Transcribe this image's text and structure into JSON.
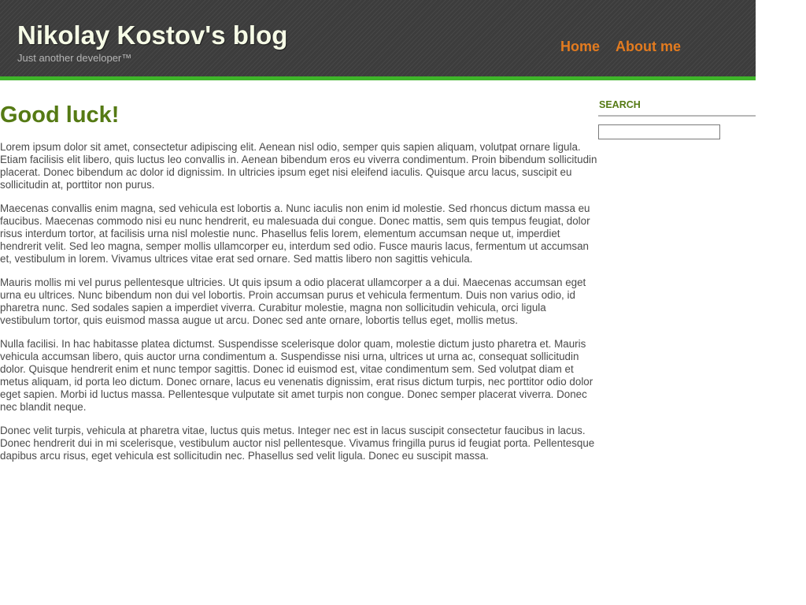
{
  "header": {
    "site_title": "Nikolay Kostov's blog",
    "tagline": "Just another developer™",
    "nav": [
      {
        "label": "Home"
      },
      {
        "label": "About me"
      }
    ]
  },
  "post": {
    "title": "Good luck!",
    "paragraphs": [
      "Lorem ipsum dolor sit amet, consectetur adipiscing elit. Aenean nisl odio, semper quis sapien aliquam, volutpat ornare ligula. Etiam facilisis elit libero, quis luctus leo convallis in. Aenean bibendum eros eu viverra condimentum. Proin bibendum sollicitudin placerat. Donec bibendum ac dolor id dignissim. In ultricies ipsum eget nisi eleifend iaculis. Quisque arcu lacus, suscipit eu sollicitudin at, porttitor non purus.",
      "Maecenas convallis enim magna, sed vehicula est lobortis a. Nunc iaculis non enim id molestie. Sed rhoncus dictum massa eu faucibus. Maecenas commodo nisi eu nunc hendrerit, eu malesuada dui congue. Donec mattis, sem quis tempus feugiat, dolor risus interdum tortor, at facilisis urna nisl molestie nunc. Phasellus felis lorem, elementum accumsan neque ut, imperdiet hendrerit velit. Sed leo magna, semper mollis ullamcorper eu, interdum sed odio. Fusce mauris lacus, fermentum ut accumsan et, vestibulum in lorem. Vivamus ultrices vitae erat sed ornare. Sed mattis libero non sagittis vehicula.",
      "Mauris mollis mi vel purus pellentesque ultricies. Ut quis ipsum a odio placerat ullamcorper a a dui. Maecenas accumsan eget urna eu ultrices. Nunc bibendum non dui vel lobortis. Proin accumsan purus et vehicula fermentum. Duis non varius odio, id pharetra nunc. Sed sodales sapien a imperdiet viverra. Curabitur molestie, magna non sollicitudin vehicula, orci ligula vestibulum tortor, quis euismod massa augue ut arcu. Donec sed ante ornare, lobortis tellus eget, mollis metus.",
      "Nulla facilisi. In hac habitasse platea dictumst. Suspendisse scelerisque dolor quam, molestie dictum justo pharetra et. Mauris vehicula accumsan libero, quis auctor urna condimentum a. Suspendisse nisi urna, ultrices ut urna ac, consequat sollicitudin dolor. Quisque hendrerit enim et nunc tempor sagittis. Donec id euismod est, vitae condimentum sem. Sed volutpat diam et metus aliquam, id porta leo dictum. Donec ornare, lacus eu venenatis dignissim, erat risus dictum turpis, nec porttitor odio dolor eget sapien. Morbi id luctus massa. Pellentesque vulputate sit amet turpis non congue. Donec semper placerat viverra. Donec nec blandit neque.",
      "Donec velit turpis, vehicula at pharetra vitae, luctus quis metus. Integer nec est in lacus suscipit consectetur faucibus in lacus. Donec hendrerit dui in mi scelerisque, vestibulum auctor nisl pellentesque. Vivamus fringilla purus id feugiat porta. Pellentesque dapibus arcu risus, eget vehicula est sollicitudin nec. Phasellus sed velit ligula. Donec eu suscipit massa."
    ]
  },
  "sidebar": {
    "search_title": "SEARCH",
    "search_value": ""
  },
  "colors": {
    "header_background": "#3c3c3c",
    "accent_green": "#3fb52a",
    "title_green": "#557a14",
    "nav_orange": "#e37b1f",
    "body_text": "#4a4a4a"
  }
}
